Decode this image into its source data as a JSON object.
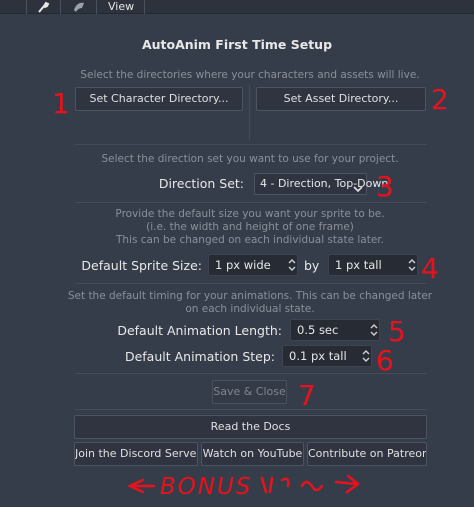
{
  "topbar": {
    "view_label": "View"
  },
  "title": "AutoAnim First Time Setup",
  "directories": {
    "hint": "Select the directories where your characters and assets will live.",
    "character_button": "Set Character Directory...",
    "asset_button": "Set Asset Directory..."
  },
  "direction": {
    "hint": "Select the direction set you want to use for your project.",
    "label": "Direction Set:",
    "selected": "4 - Direction, Top-Down"
  },
  "sprite_size": {
    "hint_line1": "Provide the default size you want your sprite to be.",
    "hint_line2": "(i.e. the width and height of one frame)",
    "hint_line3": "This can be changed on each individual state later.",
    "label": "Default Sprite Size:",
    "width_value": "1 px wide",
    "by_label": "by",
    "height_value": "1 px tall"
  },
  "timing": {
    "hint_line1": "Set the default timing for your animations.  This can be changed later",
    "hint_line2": "on each individual state.",
    "length_label": "Default Animation Length:",
    "length_value": "0.5 sec",
    "step_label": "Default Animation Step:",
    "step_value": "0.1 px tall"
  },
  "save_button": "Save & Close",
  "links": {
    "docs": "Read the Docs",
    "discord": "Join the Discord Server",
    "youtube": "Watch on YouTube",
    "patreon": "Contribute on Patreon"
  },
  "annotations": {
    "n1": "1",
    "n2": "2",
    "n3": "3",
    "n4": "4",
    "n5": "5",
    "n6": "6",
    "n7": "7",
    "bonus": "BONUS",
    "color": "#e8121c"
  }
}
